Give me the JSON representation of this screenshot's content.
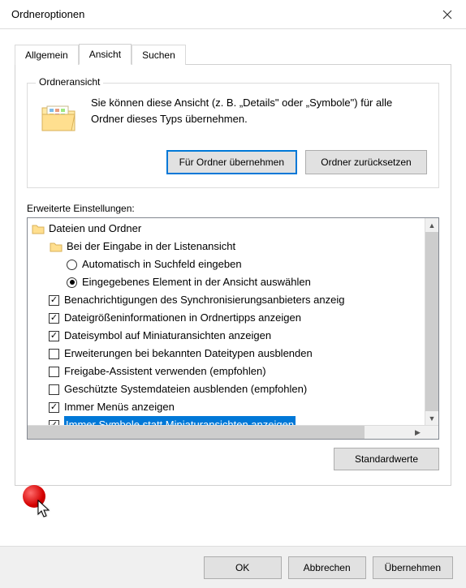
{
  "window": {
    "title": "Ordneroptionen"
  },
  "tabs": {
    "general": "Allgemein",
    "view": "Ansicht",
    "search": "Suchen",
    "active": "view"
  },
  "folderview_group": {
    "legend": "Ordneransicht",
    "description": "Sie können diese Ansicht (z. B. „Details\" oder „Symbole\") für alle Ordner dieses Typs übernehmen.",
    "apply_btn": "Für Ordner übernehmen",
    "reset_btn": "Ordner zurücksetzen"
  },
  "advanced": {
    "label": "Erweiterte Einstellungen:",
    "root": "Dateien und Ordner",
    "typing_group": "Bei der Eingabe in der Listenansicht",
    "typing_opt_auto": "Automatisch in Suchfeld eingeben",
    "typing_opt_select": "Eingegebenes Element in der Ansicht auswählen",
    "items": [
      {
        "label": "Benachrichtigungen des Synchronisierungsanbieters anzeig",
        "checked": true
      },
      {
        "label": "Dateigrößeninformationen in Ordnertipps anzeigen",
        "checked": true
      },
      {
        "label": "Dateisymbol auf Miniaturansichten anzeigen",
        "checked": true
      },
      {
        "label": "Erweiterungen bei bekannten Dateitypen ausblenden",
        "checked": false
      },
      {
        "label": "Freigabe-Assistent verwenden (empfohlen)",
        "checked": false
      },
      {
        "label": "Geschützte Systemdateien ausblenden (empfohlen)",
        "checked": false
      },
      {
        "label": "Immer Menüs anzeigen",
        "checked": true
      },
      {
        "label": "Immer Symbole statt Miniaturansichten anzeigen",
        "checked": true,
        "selected": true
      }
    ]
  },
  "buttons": {
    "defaults": "Standardwerte",
    "ok": "OK",
    "cancel": "Abbrechen",
    "apply": "Übernehmen"
  }
}
